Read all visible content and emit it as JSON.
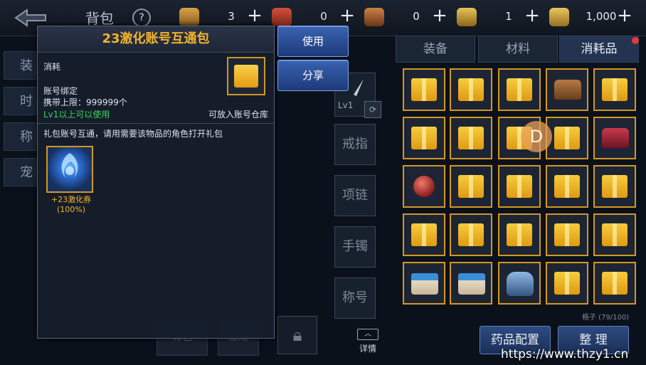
{
  "header": {
    "title": "背包",
    "help_label": "?",
    "resources": [
      {
        "icon": "coin-icon",
        "value": "3"
      },
      {
        "icon": "scroll-icon",
        "value": "0"
      },
      {
        "icon": "ticket-icon",
        "value": "0"
      },
      {
        "icon": "gold-coin-icon",
        "value": "1"
      },
      {
        "icon": "gold-pile-icon",
        "value": "1,000"
      }
    ],
    "plus_label": "+"
  },
  "sidebar_bg": [
    "装",
    "时",
    "称",
    "宠"
  ],
  "popup": {
    "title": "23激化账号互通包",
    "category": "消耗",
    "binding": "账号绑定",
    "carry_limit": "携带上限：999999个",
    "level_req": "Lv1以上可以使用",
    "storage_note": "可放入账号仓库",
    "description": "礼包账号互通，请用需要该物品的角色打开礼包",
    "reward_label": "+23激化券(100%)"
  },
  "actions": {
    "use": "使用",
    "share": "分享"
  },
  "equipment_slots": {
    "weapon_level": "Lv1",
    "ring": "戒指",
    "necklace": "项链",
    "bracelet": "手镯",
    "title": "称号"
  },
  "tabs": [
    "装备",
    "材料",
    "消耗品"
  ],
  "grid_badge": "D",
  "capacity": "格子 (79/100)",
  "bottom": {
    "potion": "药品配置",
    "sort": "整 理",
    "detail": "详情",
    "hidden_left": "背包",
    "hidden_mid": "生活"
  },
  "watermark": "https://www.thzy1.cn",
  "colors": {
    "accent_gold": "#f3b32c",
    "button_blue": "#2d4b7f",
    "green": "#39d35a"
  }
}
